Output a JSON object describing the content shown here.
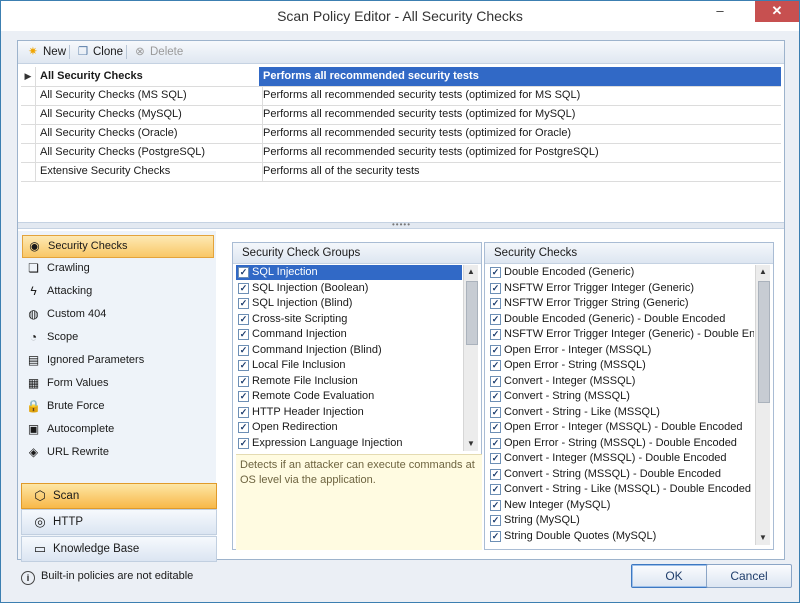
{
  "window": {
    "title": "Scan Policy Editor - All Security Checks",
    "minimize": "–",
    "maximize": "□",
    "close": "✕"
  },
  "toolbar": {
    "new_label": "New",
    "clone_label": "Clone",
    "delete_label": "Delete"
  },
  "policies": [
    {
      "name": "All Security Checks",
      "description": "Performs all recommended security tests",
      "selected": true
    },
    {
      "name": "All Security Checks (MS SQL)",
      "description": "Performs all recommended security tests (optimized for MS SQL)"
    },
    {
      "name": "All Security Checks (MySQL)",
      "description": "Performs all recommended security tests (optimized for MySQL)"
    },
    {
      "name": "All Security Checks (Oracle)",
      "description": "Performs all recommended security tests (optimized for Oracle)"
    },
    {
      "name": "All Security Checks (PostgreSQL)",
      "description": "Performs all recommended security tests (optimized for PostgreSQL)"
    },
    {
      "name": "Extensive Security Checks",
      "description": "Performs all of the security tests"
    }
  ],
  "nav": {
    "items": [
      {
        "label": "Security Checks",
        "icon": "security-checks-icon",
        "active": true
      },
      {
        "label": "Crawling",
        "icon": "crawling-icon"
      },
      {
        "label": "Attacking",
        "icon": "attacking-icon"
      },
      {
        "label": "Custom 404",
        "icon": "custom-404-icon"
      },
      {
        "label": "Scope",
        "icon": "scope-icon"
      },
      {
        "label": "Ignored Parameters",
        "icon": "ignored-parameters-icon"
      },
      {
        "label": "Form Values",
        "icon": "form-values-icon"
      },
      {
        "label": "Brute Force",
        "icon": "brute-force-icon"
      },
      {
        "label": "Autocomplete",
        "icon": "autocomplete-icon"
      },
      {
        "label": "URL Rewrite",
        "icon": "url-rewrite-icon"
      }
    ],
    "panes": [
      {
        "label": "Scan",
        "icon": "scan-icon",
        "active": true
      },
      {
        "label": "HTTP",
        "icon": "http-icon"
      },
      {
        "label": "Knowledge Base",
        "icon": "knowledge-base-icon"
      }
    ]
  },
  "groups_panel": {
    "header": "Security Check Groups",
    "items": [
      {
        "label": "SQL Injection",
        "checked": true,
        "selected": true
      },
      {
        "label": "SQL Injection (Boolean)",
        "checked": true
      },
      {
        "label": "SQL Injection (Blind)",
        "checked": true
      },
      {
        "label": "Cross-site Scripting",
        "checked": true
      },
      {
        "label": "Command Injection",
        "checked": true
      },
      {
        "label": "Command Injection (Blind)",
        "checked": true
      },
      {
        "label": "Local File Inclusion",
        "checked": true
      },
      {
        "label": "Remote File Inclusion",
        "checked": true
      },
      {
        "label": "Remote Code Evaluation",
        "checked": true
      },
      {
        "label": "HTTP Header Injection",
        "checked": true
      },
      {
        "label": "Open Redirection",
        "checked": true
      },
      {
        "label": "Expression Language Injection",
        "checked": true
      }
    ],
    "description": "Detects if an attacker can execute commands at OS level via the application."
  },
  "checks_panel": {
    "header": "Security Checks",
    "items": [
      {
        "label": "Double Encoded (Generic)",
        "checked": true
      },
      {
        "label": "NSFTW Error Trigger Integer (Generic)",
        "checked": true
      },
      {
        "label": "NSFTW  Error Trigger String (Generic)",
        "checked": true
      },
      {
        "label": "Double Encoded (Generic) - Double Encoded",
        "checked": true
      },
      {
        "label": "NSFTW Error Trigger Integer (Generic) - Double Enc",
        "checked": true
      },
      {
        "label": "Open Error - Integer (MSSQL)",
        "checked": true
      },
      {
        "label": "Open Error - String (MSSQL)",
        "checked": true
      },
      {
        "label": "Convert - Integer (MSSQL)",
        "checked": true
      },
      {
        "label": "Convert - String (MSSQL)",
        "checked": true
      },
      {
        "label": "Convert - String - Like (MSSQL)",
        "checked": true
      },
      {
        "label": "Open Error - Integer (MSSQL) - Double Encoded",
        "checked": true
      },
      {
        "label": "Open Error - String (MSSQL) - Double Encoded",
        "checked": true
      },
      {
        "label": "Convert - Integer (MSSQL) - Double Encoded",
        "checked": true
      },
      {
        "label": "Convert - String (MSSQL) - Double Encoded",
        "checked": true
      },
      {
        "label": "Convert - String - Like (MSSQL) - Double Encoded",
        "checked": true
      },
      {
        "label": "New Integer (MySQL)",
        "checked": true
      },
      {
        "label": "String (MySQL)",
        "checked": true
      },
      {
        "label": "String Double Quotes (MySQL)",
        "checked": true
      }
    ]
  },
  "footer": {
    "info_text": "Built-in policies are not editable",
    "ok_label": "OK",
    "cancel_label": "Cancel"
  }
}
